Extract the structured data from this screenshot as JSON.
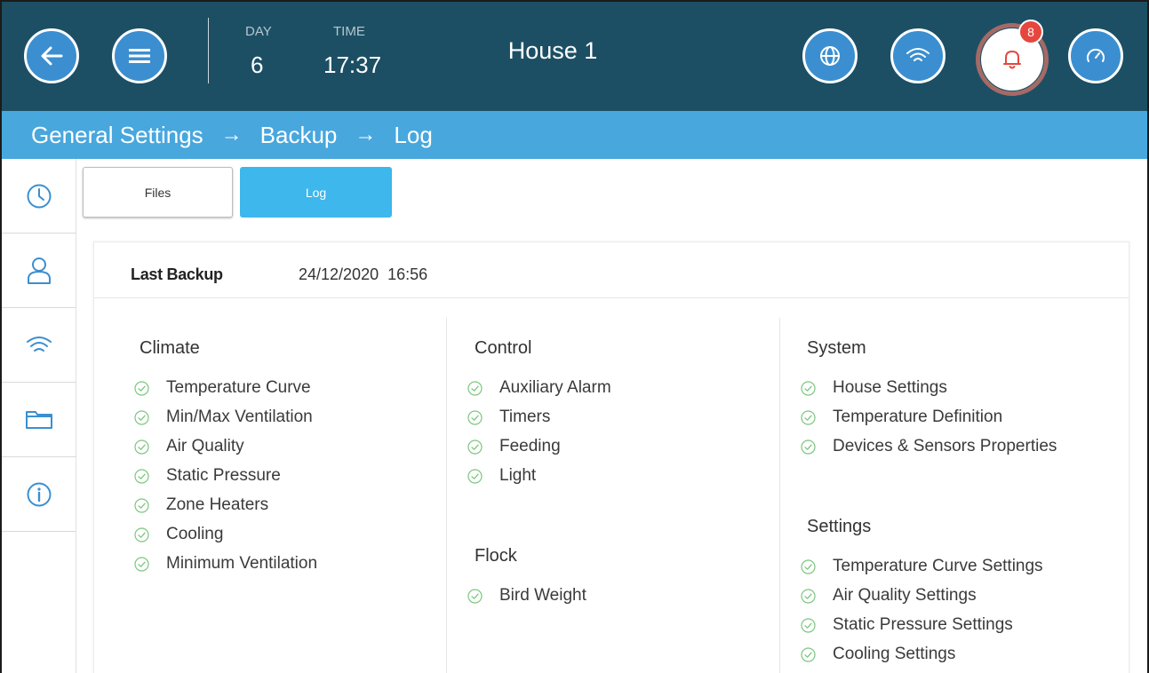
{
  "header": {
    "day_label": "DAY",
    "day_value": "6",
    "time_label": "TIME",
    "time_value": "17:37",
    "title": "House 1",
    "alarm_count": "8"
  },
  "breadcrumb": {
    "items": [
      "General Settings",
      "Backup",
      "Log"
    ],
    "separator": "→"
  },
  "sidebar": {
    "icons": [
      "clock-icon",
      "user-icon",
      "wifi-icon",
      "folder-icon",
      "info-icon"
    ]
  },
  "tabs": {
    "files": "Files",
    "log": "Log",
    "active": "Log"
  },
  "last_backup": {
    "label": "Last Backup",
    "value": "24/12/2020  16:56"
  },
  "sections": {
    "climate": {
      "title": "Climate",
      "items": [
        "Temperature Curve",
        "Min/Max Ventilation",
        "Air Quality",
        "Static Pressure",
        "Zone Heaters",
        "Cooling",
        "Minimum Ventilation"
      ]
    },
    "control": {
      "title": "Control",
      "items": [
        "Auxiliary Alarm",
        "Timers",
        "Feeding",
        "Light"
      ]
    },
    "flock": {
      "title": "Flock",
      "items": [
        "Bird Weight"
      ]
    },
    "system": {
      "title": "System",
      "items": [
        "House Settings",
        "Temperature Definition",
        "Devices & Sensors Properties"
      ]
    },
    "settings": {
      "title": "Settings",
      "items": [
        "Temperature Curve Settings",
        "Air Quality Settings",
        "Static Pressure Settings",
        "Cooling Settings"
      ]
    }
  },
  "colors": {
    "topbar": "#1c4f64",
    "breadcrumb_bar": "#48a7dd",
    "button_blue": "#3b8fd0",
    "active_tab": "#3db7ec",
    "check_green": "#7bc67e",
    "alarm_red": "#e5473f"
  }
}
